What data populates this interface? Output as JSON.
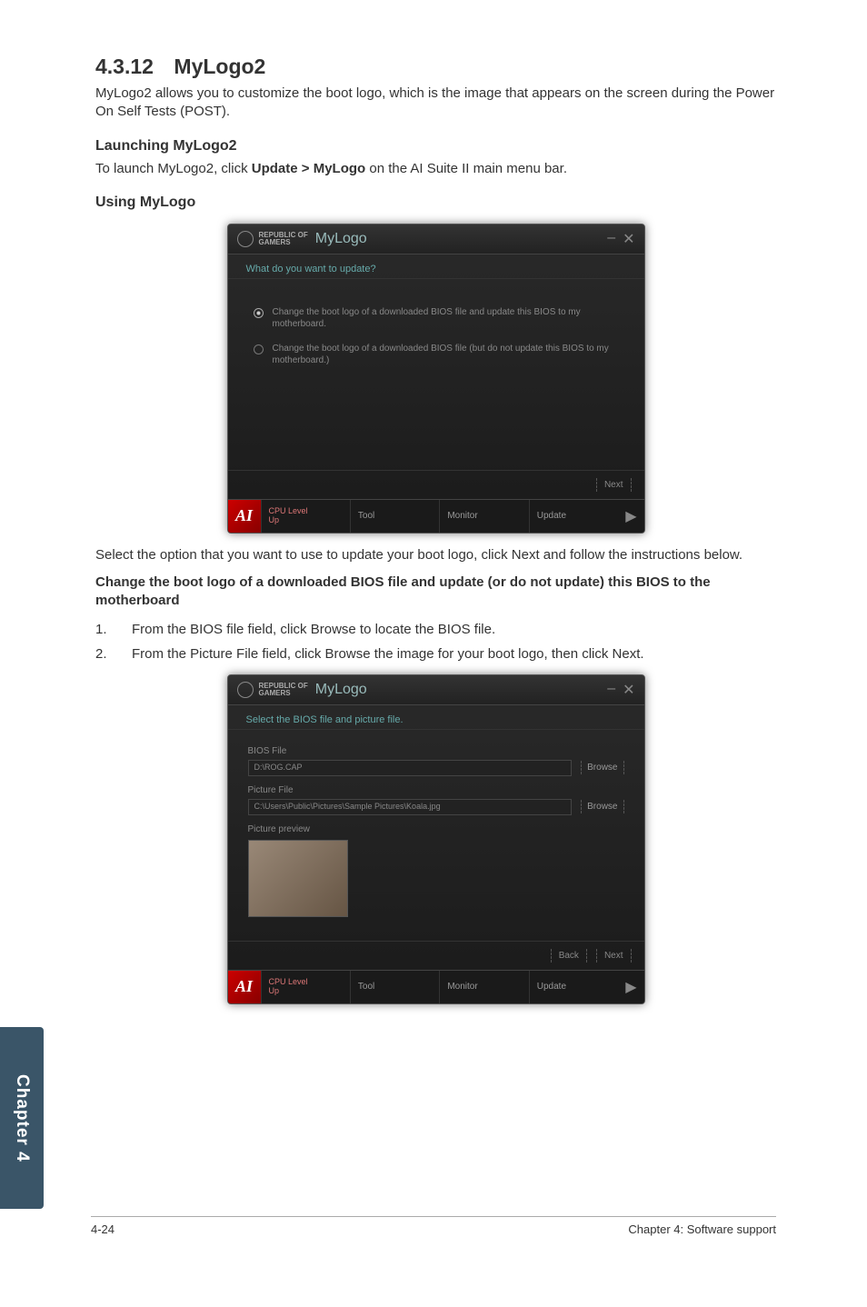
{
  "section": {
    "number": "4.3.12",
    "title": "MyLogo2",
    "intro": "MyLogo2 allows you to customize the boot logo, which is the image that appears on the screen during the Power On Self Tests (POST)."
  },
  "launching": {
    "heading": "Launching MyLogo2",
    "text_before": "To launch MyLogo2, click ",
    "text_bold": "Update > MyLogo",
    "text_after": " on the AI Suite II main menu bar."
  },
  "using": {
    "heading": "Using MyLogo"
  },
  "app1": {
    "brand": "REPUBLIC OF\nGAMERS",
    "name": "MyLogo",
    "minimize": "–",
    "close": "✕",
    "subtitle": "What do you want to update?",
    "option1": "Change the boot logo of a downloaded BIOS file and update this BIOS to my motherboard.",
    "option2": "Change the boot logo of a downloaded BIOS file (but do not update this BIOS to my motherboard.)",
    "nav_next": "Next",
    "footer_icon": "AI",
    "footer_cpu_label": "CPU Level",
    "footer_cpu_up": "Up",
    "footer_tool": "Tool",
    "footer_monitor": "Monitor",
    "footer_update": "Update",
    "footer_arrow": "▶"
  },
  "mid_para": "Select the option that you want to use to update your boot logo, click Next and follow the instructions below.",
  "change_heading": "Change the boot logo of a downloaded BIOS file and update (or do not update) this BIOS to the motherboard",
  "steps": {
    "s1_num": "1.",
    "s1_text": "From the BIOS file field, click Browse to locate the BIOS file.",
    "s2_num": "2.",
    "s2_text": "From the Picture File field, click Browse the image for your boot logo, then click Next."
  },
  "app2": {
    "brand": "REPUBLIC OF\nGAMERS",
    "name": "MyLogo",
    "minimize": "–",
    "close": "✕",
    "subtitle": "Select the BIOS file and picture file.",
    "bios_label": "BIOS File",
    "bios_value": "D:\\ROG.CAP",
    "browse": "Browse",
    "pic_label": "Picture File",
    "pic_value": "C:\\Users\\Public\\Pictures\\Sample Pictures\\Koala.jpg",
    "preview_label": "Picture preview",
    "nav_back": "Back",
    "nav_next": "Next",
    "footer_icon": "AI",
    "footer_cpu_label": "CPU Level",
    "footer_cpu_up": "Up",
    "footer_tool": "Tool",
    "footer_monitor": "Monitor",
    "footer_update": "Update",
    "footer_arrow": "▶"
  },
  "side_tab": "Chapter 4",
  "page_footer": {
    "left": "4-24",
    "right": "Chapter 4: Software support"
  }
}
